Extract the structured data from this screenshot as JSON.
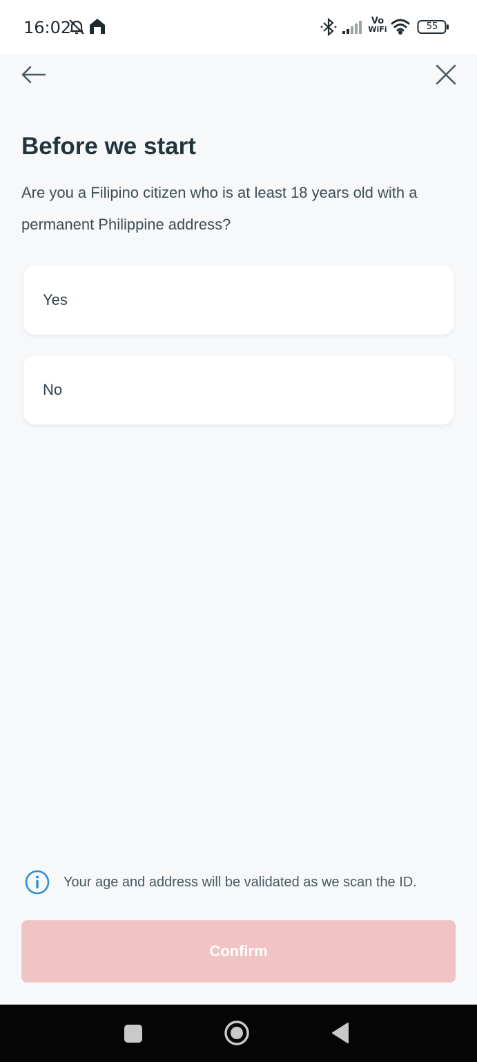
{
  "status_bar": {
    "time": "16:02",
    "battery": "55",
    "icons": [
      "mute-bell-icon",
      "home-notification-icon",
      "bluetooth-icon",
      "signal-icon",
      "vowifi-icon",
      "wifi-icon",
      "battery-icon"
    ],
    "vowifi_top": "Vo",
    "vowifi_bottom": "WiFi"
  },
  "app_bar": {
    "back_icon": "arrow-left-icon",
    "close_icon": "close-icon"
  },
  "main": {
    "title": "Before we start",
    "question": "Are you a Filipino citizen who is at least 18 years old with a permanent Philippine address?",
    "options": [
      {
        "label": "Yes"
      },
      {
        "label": "No"
      }
    ]
  },
  "footer": {
    "info_icon": "info-icon",
    "info_text": "Your age and address will be validated as we scan the ID.",
    "confirm_label": "Confirm"
  },
  "colors": {
    "background": "#f6f8fa",
    "title": "#23343d",
    "confirm_disabled": "#f2c3c5",
    "info_accent": "#2f8fce"
  }
}
